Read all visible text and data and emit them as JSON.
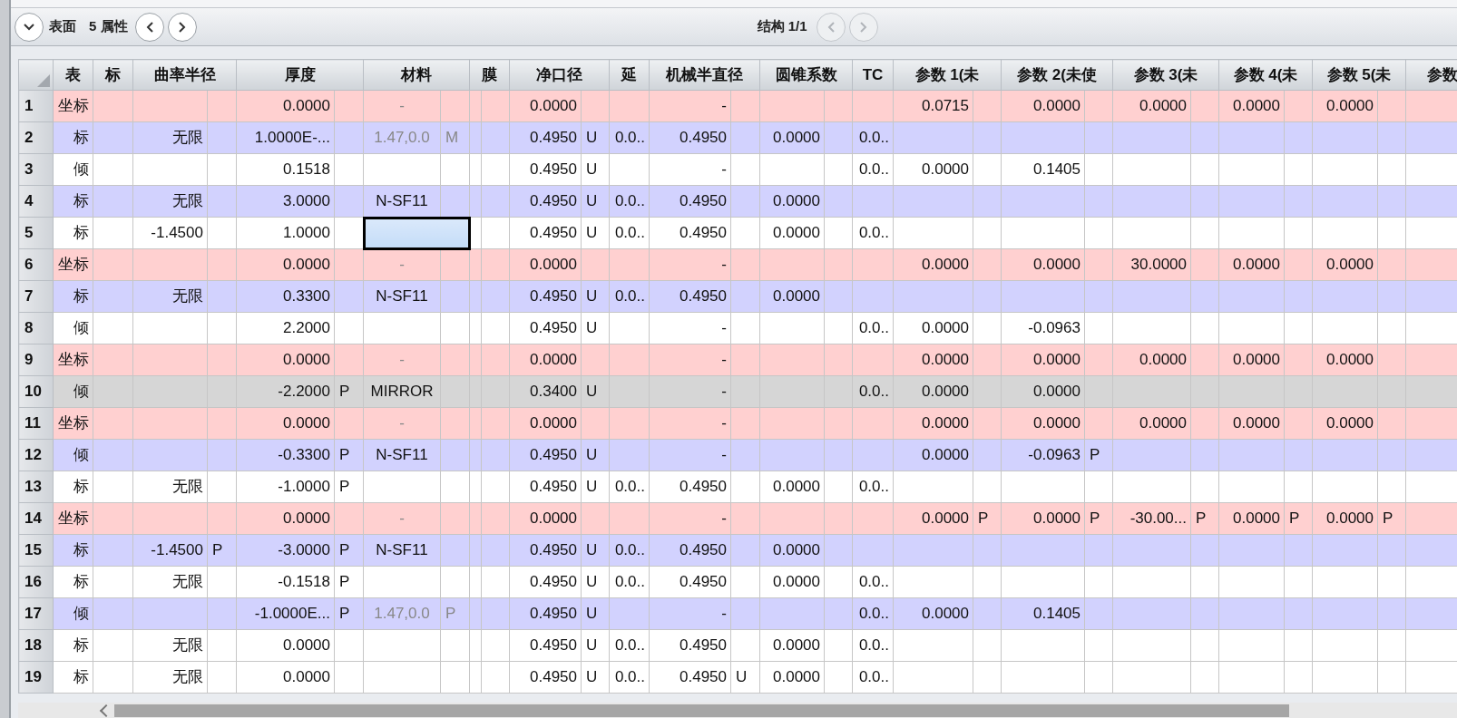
{
  "toolbar": {
    "surface_label": "表面",
    "properties_label": "5 属性",
    "structure_label": "结构 1/1"
  },
  "table": {
    "columns": [
      "表",
      "标",
      "曲率半径",
      "厚度",
      "材料",
      "膜",
      "净口径",
      "延",
      "机械半直径",
      "圆锥系数",
      "TC",
      "参数 1(未",
      "参数 2(未使",
      "参数 3(未",
      "参数 4(未",
      "参数 5(未",
      "参数"
    ],
    "rows": [
      {
        "number": "1",
        "color": "#ffd0d0",
        "material_dim": true,
        "material_selected": false,
        "cells": [
          "坐标",
          null,
          null,
          {
            "value": "0.0000"
          },
          {
            "value": "-"
          },
          null,
          {
            "value": "0.0000"
          },
          null,
          {
            "value": "-"
          },
          null,
          null,
          {
            "value": "0.0715"
          },
          {
            "value": "0.0000"
          },
          {
            "value": "0.0000"
          },
          {
            "value": "0.0000"
          },
          {
            "value": "0.0000"
          },
          null
        ]
      },
      {
        "number": "2",
        "color": "#d2d2fe",
        "material_dim": true,
        "material_selected": false,
        "cells": [
          "标",
          null,
          {
            "value": "无限"
          },
          {
            "value": "1.0000E-..."
          },
          {
            "value": "1.47,0.0",
            "solve": "M"
          },
          null,
          {
            "value": "0.4950",
            "solve": "U"
          },
          "0.0..",
          {
            "value": "0.4950"
          },
          {
            "value": "0.0000"
          },
          "0.0.."
        ]
      },
      {
        "number": "3",
        "color": "#ffffff",
        "material_dim": false,
        "material_selected": false,
        "cells": [
          "倾",
          null,
          null,
          {
            "value": "0.1518"
          },
          null,
          null,
          {
            "value": "0.4950",
            "solve": "U"
          },
          null,
          {
            "value": "-"
          },
          null,
          "0.0..",
          {
            "value": "0.0000"
          },
          {
            "value": "0.1405"
          }
        ]
      },
      {
        "number": "4",
        "color": "#d2d2fe",
        "material_dim": false,
        "material_selected": false,
        "cells": [
          "标",
          null,
          {
            "value": "无限"
          },
          {
            "value": "3.0000"
          },
          {
            "value": "N-SF11"
          },
          null,
          {
            "value": "0.4950",
            "solve": "U"
          },
          "0.0..",
          {
            "value": "0.4950"
          },
          {
            "value": "0.0000"
          }
        ]
      },
      {
        "number": "5",
        "color": "#ffffff",
        "material_dim": false,
        "material_selected": true,
        "cells": [
          "标",
          null,
          {
            "value": "-1.4500"
          },
          {
            "value": "1.0000"
          },
          null,
          null,
          {
            "value": "0.4950",
            "solve": "U"
          },
          "0.0..",
          {
            "value": "0.4950"
          },
          {
            "value": "0.0000"
          },
          "0.0.."
        ]
      },
      {
        "number": "6",
        "color": "#ffd0d0",
        "material_dim": true,
        "material_selected": false,
        "cells": [
          "坐标",
          null,
          null,
          {
            "value": "0.0000"
          },
          {
            "value": "-"
          },
          null,
          {
            "value": "0.0000"
          },
          null,
          {
            "value": "-"
          },
          null,
          null,
          {
            "value": "0.0000"
          },
          {
            "value": "0.0000"
          },
          {
            "value": "30.0000"
          },
          {
            "value": "0.0000"
          },
          {
            "value": "0.0000"
          }
        ]
      },
      {
        "number": "7",
        "color": "#d2d2fe",
        "material_dim": false,
        "material_selected": false,
        "cells": [
          "标",
          null,
          {
            "value": "无限"
          },
          {
            "value": "0.3300"
          },
          {
            "value": "N-SF11"
          },
          null,
          {
            "value": "0.4950",
            "solve": "U"
          },
          "0.0..",
          {
            "value": "0.4950"
          },
          {
            "value": "0.0000"
          }
        ]
      },
      {
        "number": "8",
        "color": "#ffffff",
        "material_dim": false,
        "material_selected": false,
        "cells": [
          "倾",
          null,
          null,
          {
            "value": "2.2000"
          },
          null,
          null,
          {
            "value": "0.4950",
            "solve": "U"
          },
          null,
          {
            "value": "-"
          },
          null,
          "0.0..",
          {
            "value": "0.0000"
          },
          {
            "value": "-0.0963"
          }
        ]
      },
      {
        "number": "9",
        "color": "#ffd0d0",
        "material_dim": true,
        "material_selected": false,
        "cells": [
          "坐标",
          null,
          null,
          {
            "value": "0.0000"
          },
          {
            "value": "-"
          },
          null,
          {
            "value": "0.0000"
          },
          null,
          {
            "value": "-"
          },
          null,
          null,
          {
            "value": "0.0000"
          },
          {
            "value": "0.0000"
          },
          {
            "value": "0.0000"
          },
          {
            "value": "0.0000"
          },
          {
            "value": "0.0000"
          }
        ]
      },
      {
        "number": "10",
        "color": "#d6d6d6",
        "material_dim": false,
        "material_selected": false,
        "cells": [
          "倾",
          null,
          null,
          {
            "value": "-2.2000",
            "solve": "P"
          },
          {
            "value": "MIRROR"
          },
          null,
          {
            "value": "0.3400",
            "solve": "U"
          },
          null,
          {
            "value": "-"
          },
          null,
          "0.0..",
          {
            "value": "0.0000"
          },
          {
            "value": "0.0000"
          }
        ]
      },
      {
        "number": "11",
        "color": "#ffd0d0",
        "material_dim": true,
        "material_selected": false,
        "cells": [
          "坐标",
          null,
          null,
          {
            "value": "0.0000"
          },
          {
            "value": "-"
          },
          null,
          {
            "value": "0.0000"
          },
          null,
          {
            "value": "-"
          },
          null,
          null,
          {
            "value": "0.0000"
          },
          {
            "value": "0.0000"
          },
          {
            "value": "0.0000"
          },
          {
            "value": "0.0000"
          },
          {
            "value": "0.0000"
          }
        ]
      },
      {
        "number": "12",
        "color": "#d2d2fe",
        "material_dim": false,
        "material_selected": false,
        "cells": [
          "倾",
          null,
          null,
          {
            "value": "-0.3300",
            "solve": "P"
          },
          {
            "value": "N-SF11"
          },
          null,
          {
            "value": "0.4950",
            "solve": "U"
          },
          null,
          {
            "value": "-"
          },
          null,
          null,
          {
            "value": "0.0000"
          },
          {
            "value": "-0.0963",
            "solve": "P"
          }
        ]
      },
      {
        "number": "13",
        "color": "#ffffff",
        "material_dim": false,
        "material_selected": false,
        "cells": [
          "标",
          null,
          {
            "value": "无限"
          },
          {
            "value": "-1.0000",
            "solve": "P"
          },
          null,
          null,
          {
            "value": "0.4950",
            "solve": "U"
          },
          "0.0..",
          {
            "value": "0.4950"
          },
          {
            "value": "0.0000"
          },
          "0.0.."
        ]
      },
      {
        "number": "14",
        "color": "#ffd0d0",
        "material_dim": true,
        "material_selected": false,
        "cells": [
          "坐标",
          null,
          null,
          {
            "value": "0.0000"
          },
          {
            "value": "-"
          },
          null,
          {
            "value": "0.0000"
          },
          null,
          {
            "value": "-"
          },
          null,
          null,
          {
            "value": "0.0000",
            "solve": "P"
          },
          {
            "value": "0.0000",
            "solve": "P"
          },
          {
            "value": "-30.00...",
            "solve": "P"
          },
          {
            "value": "0.0000",
            "solve": "P"
          },
          {
            "value": "0.0000",
            "solve": "P"
          }
        ]
      },
      {
        "number": "15",
        "color": "#d2d2fe",
        "material_dim": false,
        "material_selected": false,
        "cells": [
          "标",
          null,
          {
            "value": "-1.4500",
            "solve": "P"
          },
          {
            "value": "-3.0000",
            "solve": "P"
          },
          {
            "value": "N-SF11"
          },
          null,
          {
            "value": "0.4950",
            "solve": "U"
          },
          "0.0..",
          {
            "value": "0.4950"
          },
          {
            "value": "0.0000"
          }
        ]
      },
      {
        "number": "16",
        "color": "#ffffff",
        "material_dim": false,
        "material_selected": false,
        "cells": [
          "标",
          null,
          {
            "value": "无限"
          },
          {
            "value": "-0.1518",
            "solve": "P"
          },
          null,
          null,
          {
            "value": "0.4950",
            "solve": "U"
          },
          "0.0..",
          {
            "value": "0.4950"
          },
          {
            "value": "0.0000"
          },
          "0.0.."
        ]
      },
      {
        "number": "17",
        "color": "#d2d2fe",
        "material_dim": true,
        "material_selected": false,
        "cells": [
          "倾",
          null,
          null,
          {
            "value": "-1.0000E...",
            "solve": "P"
          },
          {
            "value": "1.47,0.0",
            "solve": "P"
          },
          null,
          {
            "value": "0.4950",
            "solve": "U"
          },
          null,
          {
            "value": "-"
          },
          null,
          "0.0..",
          {
            "value": "0.0000"
          },
          {
            "value": "0.1405"
          }
        ]
      },
      {
        "number": "18",
        "color": "#ffffff",
        "material_dim": false,
        "material_selected": false,
        "cells": [
          "标",
          null,
          {
            "value": "无限"
          },
          {
            "value": "0.0000"
          },
          null,
          null,
          {
            "value": "0.4950",
            "solve": "U"
          },
          "0.0..",
          {
            "value": "0.4950"
          },
          {
            "value": "0.0000"
          },
          "0.0.."
        ]
      },
      {
        "number": "19",
        "color": "#ffffff",
        "material_dim": false,
        "material_selected": false,
        "cells": [
          "标",
          null,
          {
            "value": "无限"
          },
          {
            "value": "0.0000"
          },
          null,
          null,
          {
            "value": "0.4950",
            "solve": "U"
          },
          "0.0..",
          {
            "value": "0.4950",
            "solve": "U"
          },
          {
            "value": "0.0000"
          },
          "0.0.."
        ]
      }
    ]
  }
}
